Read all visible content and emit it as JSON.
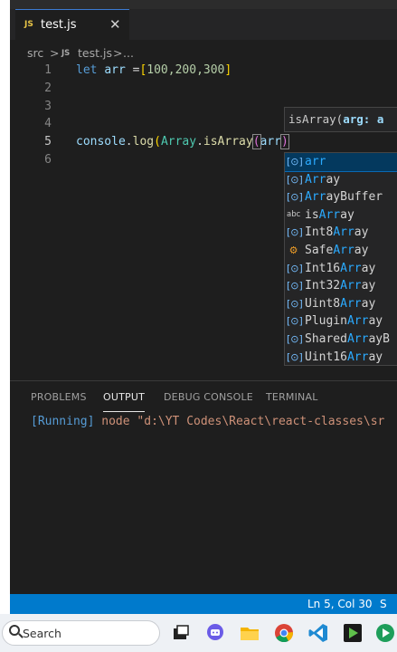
{
  "tab": {
    "badge": "JS",
    "label": "test.js",
    "close": "✕"
  },
  "breadcrumb": {
    "folder": "src",
    "sep1": ">",
    "badge": "JS",
    "file": "test.js",
    "sep2": ">",
    "more": "..."
  },
  "editor": {
    "line_numbers": [
      "1",
      "2",
      "3",
      "4",
      "5",
      "6"
    ],
    "line1": {
      "kw": "let",
      "var": "arr",
      "eq": " =",
      "open": "[",
      "values": "100,200,300",
      "close": "]"
    },
    "line5": {
      "obj": "console",
      "dot1": ".",
      "method": "log",
      "p1": "(",
      "cls": "Array",
      "dot2": ".",
      "fn": "isArray",
      "p2": "(",
      "arg": "arr",
      "p3": ")"
    }
  },
  "param_hint": {
    "name": "isArray(",
    "arg": "arg: a"
  },
  "suggestions": [
    {
      "icon": "variable-icon",
      "glyph": "[⊙]",
      "prefix": "",
      "match": "arr",
      "suffix": "",
      "selected": true
    },
    {
      "icon": "variable-icon",
      "glyph": "[⊙]",
      "prefix": "",
      "match": "Arr",
      "suffix": "ay",
      "selected": false
    },
    {
      "icon": "variable-icon",
      "glyph": "[⊙]",
      "prefix": "",
      "match": "Arr",
      "suffix": "ayBuffer",
      "selected": false
    },
    {
      "icon": "text-icon",
      "glyph": "abc",
      "prefix": "is",
      "match": "Arr",
      "suffix": "ay",
      "selected": false
    },
    {
      "icon": "variable-icon",
      "glyph": "[⊙]",
      "prefix": "Int8",
      "match": "Arr",
      "suffix": "ay",
      "selected": false
    },
    {
      "icon": "module-icon",
      "glyph": "⚙",
      "prefix": "Safe",
      "match": "Arr",
      "suffix": "ay",
      "selected": false
    },
    {
      "icon": "variable-icon",
      "glyph": "[⊙]",
      "prefix": "Int16",
      "match": "Arr",
      "suffix": "ay",
      "selected": false
    },
    {
      "icon": "variable-icon",
      "glyph": "[⊙]",
      "prefix": "Int32",
      "match": "Arr",
      "suffix": "ay",
      "selected": false
    },
    {
      "icon": "variable-icon",
      "glyph": "[⊙]",
      "prefix": "Uint8",
      "match": "Arr",
      "suffix": "ay",
      "selected": false
    },
    {
      "icon": "variable-icon",
      "glyph": "[⊙]",
      "prefix": "Plugin",
      "match": "Arr",
      "suffix": "ay",
      "selected": false
    },
    {
      "icon": "variable-icon",
      "glyph": "[⊙]",
      "prefix": "Shared",
      "match": "Arr",
      "suffix": "ayB",
      "selected": false
    },
    {
      "icon": "variable-icon",
      "glyph": "[⊙]",
      "prefix": "Uint16",
      "match": "Arr",
      "suffix": "ay",
      "selected": false
    }
  ],
  "panel": {
    "tabs": [
      "PROBLEMS",
      "OUTPUT",
      "DEBUG CONSOLE",
      "TERMINAL"
    ],
    "active_tab": "OUTPUT",
    "output_running": "[Running]",
    "output_cmd": " node \"d:\\YT Codes\\React\\react-classes\\sr"
  },
  "status": {
    "position": "Ln 5, Col 30",
    "extra": "S"
  },
  "taskbar": {
    "search_placeholder": "Search"
  },
  "colors": {
    "statusbar": "#007acc",
    "editor_bg": "#1e1e1e",
    "accent": "#2aaaff"
  }
}
